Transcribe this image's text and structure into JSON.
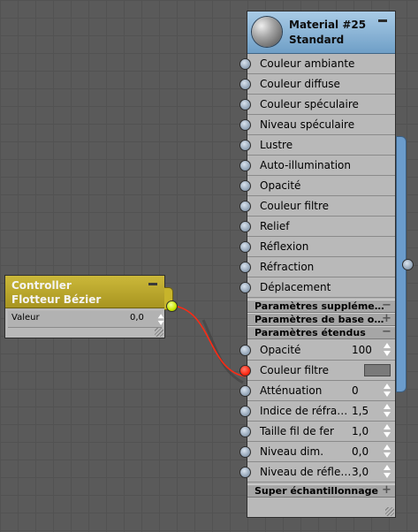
{
  "material_node": {
    "title": "Material #25",
    "subtitle": "Standard",
    "slots": [
      {
        "label": "Couleur ambiante"
      },
      {
        "label": "Couleur diffuse"
      },
      {
        "label": "Couleur spéculaire"
      },
      {
        "label": "Niveau spéculaire"
      },
      {
        "label": "Lustre"
      },
      {
        "label": "Auto-illumination"
      },
      {
        "label": "Opacité"
      },
      {
        "label": "Couleur filtre"
      },
      {
        "label": "Relief"
      },
      {
        "label": "Réflexion"
      },
      {
        "label": "Réfraction"
      },
      {
        "label": "Déplacement"
      }
    ],
    "sections": [
      {
        "label": "Paramètres suppléme…",
        "icon": "−"
      },
      {
        "label": "Paramètres de base o…",
        "icon": "+"
      },
      {
        "label": "Paramètres étendus",
        "icon": "−"
      }
    ],
    "extended_params": [
      {
        "label": "Opacité",
        "value": "100"
      },
      {
        "label": "Couleur filtre",
        "value": ""
      },
      {
        "label": "Atténuation",
        "value": "0"
      },
      {
        "label": "Indice de réfra…",
        "value": "1,5"
      },
      {
        "label": "Taille fil de fer",
        "value": "1,0"
      },
      {
        "label": "Niveau dim.",
        "value": "0,0"
      },
      {
        "label": "Niveau de réfle…",
        "value": "3,0"
      }
    ],
    "bottom_section": {
      "label": "Super échantillonnage",
      "icon": "+"
    }
  },
  "controller_node": {
    "title": "Controller",
    "subtitle": "Flotteur Bézier",
    "param_label": "Valeur",
    "param_value": "0,0"
  },
  "colors": {
    "material_header": "#6f9fc7",
    "controller_header": "#a89520",
    "wire": "#ff2a14",
    "connected_input": "#ff2a14",
    "controller_output": "#c9e600"
  }
}
